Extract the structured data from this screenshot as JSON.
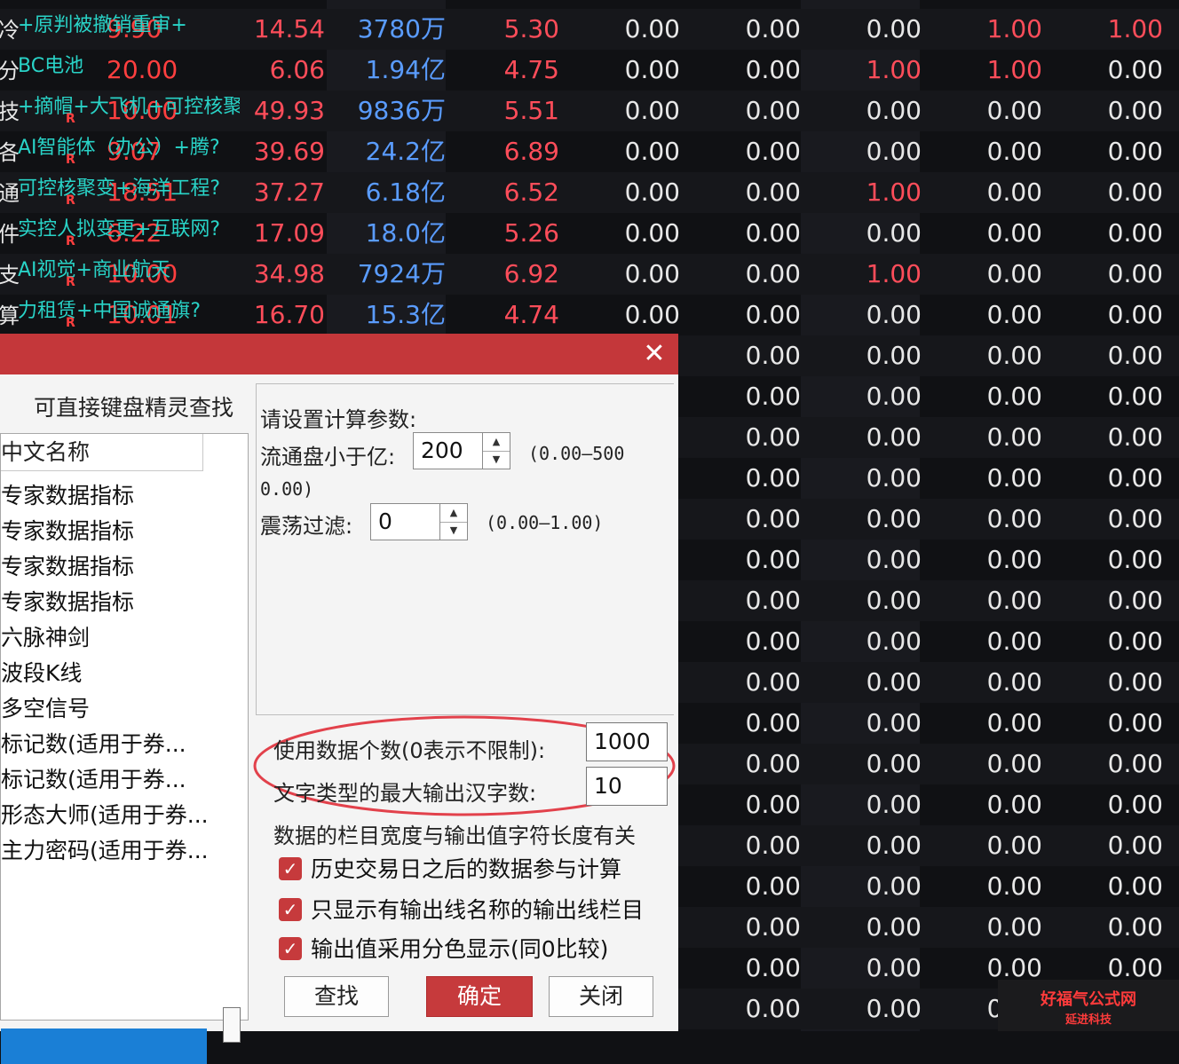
{
  "top_rows": [
    {
      "label": "冷",
      "tag": "+原判被撤销重审+",
      "price": "9.90",
      "c1": "14.54",
      "c2": "3780万",
      "c3": "5.30",
      "c4": "0.00",
      "c5": "0.00",
      "c6": "0.00",
      "c7": "1.00",
      "c8": "1.00"
    },
    {
      "label": "分",
      "tag": "BC电池",
      "price": "20.00",
      "c1": "6.06",
      "c2": "1.94亿",
      "c3": "4.75",
      "c4": "0.00",
      "c5": "0.00",
      "c6": "1.00",
      "c7": "1.00",
      "c8": "0.00"
    },
    {
      "label": "技",
      "tag": "+摘帽+大飞机+可控核聚",
      "price": "10.00",
      "c1": "49.93",
      "c2": "9836万",
      "c3": "5.51",
      "c4": "0.00",
      "c5": "0.00",
      "c6": "0.00",
      "c7": "0.00",
      "c8": "0.00"
    },
    {
      "label": "各",
      "tag": "AI智能体（办公）+腾?",
      "price": "9.07",
      "c1": "39.69",
      "c2": "24.2亿",
      "c3": "6.89",
      "c4": "0.00",
      "c5": "0.00",
      "c6": "0.00",
      "c7": "0.00",
      "c8": "0.00"
    },
    {
      "label": "通",
      "tag": "可控核聚变+海洋工程?",
      "price": "18.51",
      "c1": "37.27",
      "c2": "6.18亿",
      "c3": "6.52",
      "c4": "0.00",
      "c5": "0.00",
      "c6": "1.00",
      "c7": "0.00",
      "c8": "0.00"
    },
    {
      "label": "件",
      "tag": "实控人拟变更+互联网?",
      "price": "6.22",
      "c1": "17.09",
      "c2": "18.0亿",
      "c3": "5.26",
      "c4": "0.00",
      "c5": "0.00",
      "c6": "0.00",
      "c7": "0.00",
      "c8": "0.00"
    },
    {
      "label": "支",
      "tag": "AI视觉+商业航天",
      "price": "10.00",
      "c1": "34.98",
      "c2": "7924万",
      "c3": "6.92",
      "c4": "0.00",
      "c5": "0.00",
      "c6": "1.00",
      "c7": "0.00",
      "c8": "0.00"
    },
    {
      "label": "算",
      "tag": "力租赁+中国诚通旗?",
      "price": "10.01",
      "c1": "16.70",
      "c2": "15.3亿",
      "c3": "4.74",
      "c4": "0.00",
      "c5": "0.00",
      "c6": "0.00",
      "c7": "0.00",
      "c8": "0.00"
    }
  ],
  "lower_rows_value": "0.00",
  "lower_rows_count": 17,
  "dialog": {
    "close_glyph": "✕",
    "hint": "可直接键盘精灵查找",
    "list_header": "中文名称",
    "list_items": [
      "专家数据指标",
      "专家数据指标",
      "专家数据指标",
      "专家数据指标",
      "六脉神剑",
      "波段K线",
      "多空信号",
      "标记数(适用于券...",
      "标记数(适用于券...",
      "形态大师(适用于券...",
      "主力密码(适用于券..."
    ],
    "params_title": "请设置计算参数:",
    "param1_label": "流通盘小于亿:",
    "param1_value": "200",
    "param1_range": "(0.00—500",
    "param1_range_cont": "0.00)",
    "param2_label": "震荡过滤:",
    "param2_value": "0",
    "param2_range": "(0.00—1.00)",
    "count_label": "使用数据个数(0表示不限制):",
    "count_value": "1000",
    "maxchars_label": "文字类型的最大输出汉字数:",
    "maxchars_value": "10",
    "width_note": "数据的栏目宽度与输出值字符长度有关",
    "checkboxes": [
      {
        "label": "历史交易日之后的数据参与计算",
        "checked": true
      },
      {
        "label": "只显示有输出线名称的输出线栏目",
        "checked": true
      },
      {
        "label": "输出值采用分色显示(同0比较)",
        "checked": true
      }
    ],
    "btn_find": "查找",
    "btn_ok": "确定",
    "btn_close": "关闭"
  },
  "watermark": {
    "line1": "好福气公式网",
    "line2": "延进科技"
  },
  "colors": {
    "accent": "#c4373a",
    "up": "#ff4d5a",
    "blue": "#5a9cff",
    "tag": "#29d3c7"
  }
}
